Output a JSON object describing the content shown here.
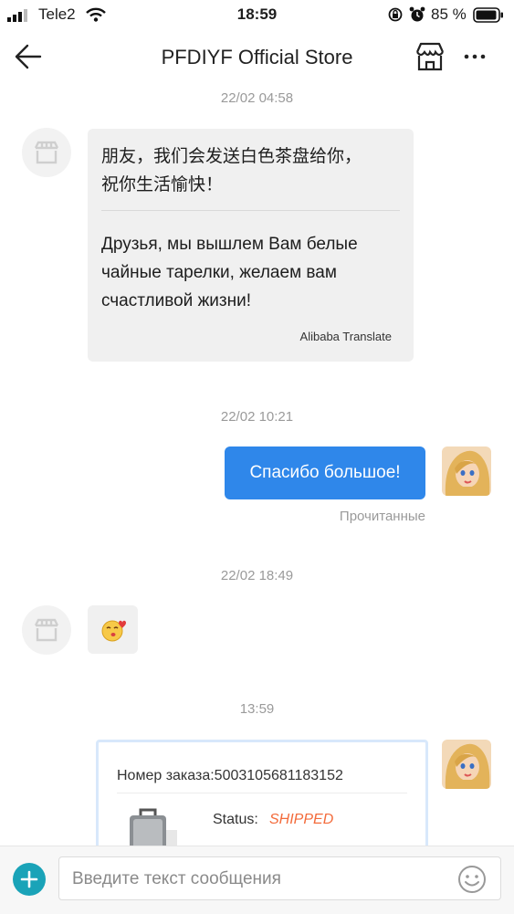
{
  "status_bar": {
    "carrier": "Tele2",
    "time": "18:59",
    "battery": "85 %"
  },
  "header": {
    "title": "PFDIYF Official Store",
    "back_icon": "back-arrow-icon",
    "store_icon": "store-icon",
    "more_icon": "more-icon"
  },
  "messages": [
    {
      "timestamp": "22/02 04:58",
      "from": "store",
      "text_original": "朋友，我们会发送白色茶盘给你，祝你生活愉快！",
      "text_original_line1": "朋友，我们会发送白色茶盘给你，",
      "text_original_line2": "祝你生活愉快！",
      "text_translated_line1": "Друзья, мы вышлем Вам белые",
      "text_translated_line2": "чайные тарелки, желаем вам",
      "text_translated_line3": "счастливой жизни!",
      "translator": "Alibaba Translate"
    },
    {
      "timestamp": "22/02 10:21",
      "from": "user",
      "text": "Спасибо большое!",
      "status": "Прочитанные"
    },
    {
      "timestamp": "22/02 18:49",
      "from": "store",
      "sticker": "kiss-emoji"
    },
    {
      "timestamp": "13:59",
      "from": "user",
      "order": {
        "number_label": "Номер заказа:5003105681183152",
        "status_label": "Status:",
        "status_value": "SHIPPED"
      }
    }
  ],
  "composer": {
    "placeholder": "Введите текст сообщения",
    "plus_icon": "plus-icon",
    "emoji_icon": "smiley-icon"
  },
  "colors": {
    "accent_blue": "#2f87ea",
    "plus_teal": "#1aa3b8",
    "shipped_orange": "#f36b3b",
    "timestamp_gray": "#9a9a9a"
  }
}
